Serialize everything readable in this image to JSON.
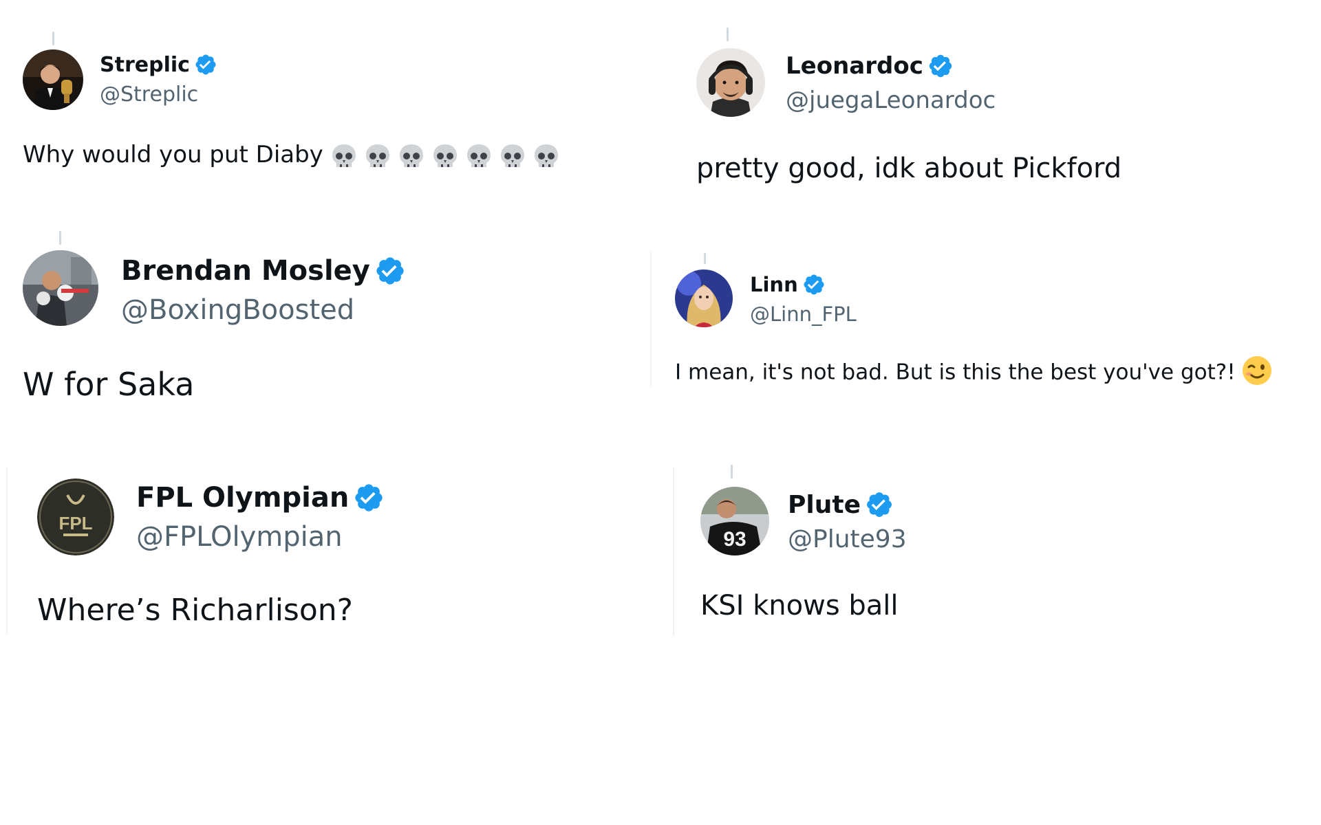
{
  "colors": {
    "verified": "#1d9bf0",
    "name": "#0f1419",
    "handle": "#536471",
    "thread_line": "#cfd9de",
    "divider": "#eff3f4"
  },
  "tweets": [
    {
      "display_name": "Streplic",
      "handle": "@Streplic",
      "text": "Why would you put Diaby",
      "emoji": "skull-icon x7",
      "avatar": "avatar-photo"
    },
    {
      "display_name": "Leonardoc",
      "handle": "@juegaLeonardoc",
      "text": "pretty good, idk about Pickford",
      "avatar": "avatar-photo"
    },
    {
      "display_name": "Brendan Mosley",
      "handle": "@BoxingBoosted",
      "text": "W for Saka",
      "avatar": "avatar-photo"
    },
    {
      "display_name": "Linn",
      "handle": "@Linn_FPL",
      "text": "I mean, it's not bad. But is this the best you've got?!",
      "emoji": "winking-face-icon",
      "avatar": "avatar-photo"
    },
    {
      "display_name": "FPL Olympian",
      "handle": "@FPLOlympian",
      "text": "Where’s Richarlison?",
      "avatar": "avatar-logo",
      "avatar_logo_text": "FPL"
    },
    {
      "display_name": "Plute",
      "handle": "@Plute93",
      "text": "KSI knows ball",
      "avatar": "avatar-photo",
      "avatar_jersey_number": "93"
    }
  ]
}
